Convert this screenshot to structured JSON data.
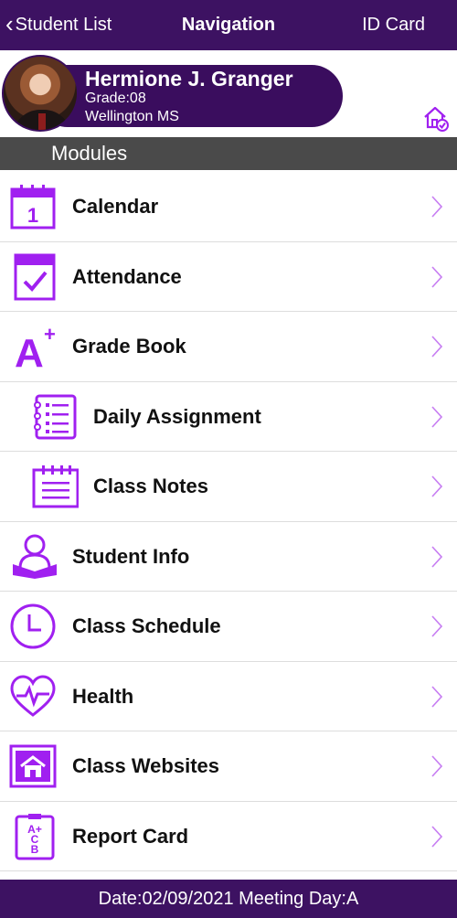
{
  "navbar": {
    "back_label": "Student List",
    "title": "Navigation",
    "right_label": "ID Card"
  },
  "student": {
    "name": "Hermione J. Granger",
    "grade": "Grade:08",
    "school": "Wellington MS"
  },
  "modules_header": "Modules",
  "modules": [
    {
      "label": "Calendar",
      "icon": "calendar-icon"
    },
    {
      "label": "Attendance",
      "icon": "attendance-check-icon"
    },
    {
      "label": "Grade Book",
      "icon": "grade-a-plus-icon"
    },
    {
      "label": "Daily Assignment",
      "icon": "assignment-notebook-icon"
    },
    {
      "label": "Class Notes",
      "icon": "notes-notepad-icon"
    },
    {
      "label": "Student Info",
      "icon": "student-reading-icon"
    },
    {
      "label": "Class Schedule",
      "icon": "clock-icon"
    },
    {
      "label": "Health",
      "icon": "heart-pulse-icon"
    },
    {
      "label": "Class Websites",
      "icon": "school-website-icon"
    },
    {
      "label": "Report Card",
      "icon": "report-card-icon"
    }
  ],
  "footer": {
    "text": "Date:02/09/2021 Meeting Day:A"
  },
  "colors": {
    "header_bg": "#3d1262",
    "accent": "#a020f0",
    "modules_bar": "#4a4a4a"
  }
}
